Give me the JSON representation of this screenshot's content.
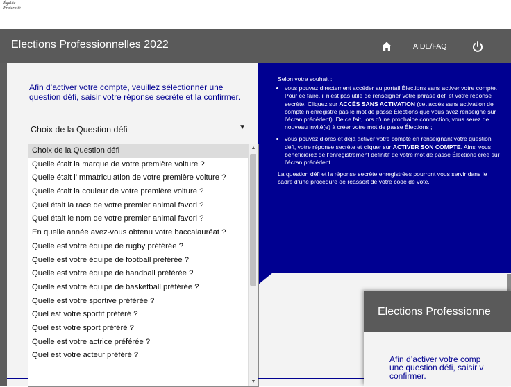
{
  "topstrip": {
    "motto_line1": "Égalité",
    "motto_line2": "Fraternité"
  },
  "header": {
    "title": "Elections Professionnelles 2022",
    "home_icon": "home-icon",
    "aide_label": "AIDE/FAQ",
    "power_icon": "power-icon"
  },
  "instruction": "Afin d’activer votre compte, veuillez sélectionner une question défi, saisir votre réponse secrète et la confirmer.",
  "question_select": {
    "selected": "Choix de la Question défi",
    "options": [
      "Choix de la Question défi",
      "Quelle était la marque de votre première voiture ?",
      "Quelle était l’immatriculation de votre première voiture ?",
      "Quelle était la couleur de votre première voiture ?",
      "Quel était la race de votre premier animal favori ?",
      "Quel était le nom de votre premier animal favori ?",
      "En quelle année avez-vous obtenu votre baccalauréat ?",
      "Quelle est votre équipe de rugby préférée ?",
      "Quelle est votre équipe de football préférée ?",
      "Quelle est votre équipe de handball préférée ?",
      "Quelle est votre équipe de basketball préférée ?",
      "Quelle est votre sportive préférée ?",
      "Quel est votre sportif préféré ?",
      "Quel est votre sport préféré ?",
      "Quelle est votre actrice préférée ?",
      "Quel est votre acteur préféré ?"
    ]
  },
  "info": {
    "intro": "Selon votre souhait :",
    "b1_pre": "vous pouvez directement accéder au portail Élections sans activer votre compte. Pour ce faire, il n’est pas utile de renseigner votre phrase défi et votre réponse secrète. Cliquez sur ",
    "b1_strong": "ACCÈS SANS ACTIVATION",
    "b1_post": " (cet accès sans activation de compte n’enregistre pas le mot de passe Élections que vous avez renseigné sur l’écran précédent). De ce fait, lors d’une prochaine connection, vous serez de nouveau invité(e) à créer votre mot de passe Élections ;",
    "b2_pre": "vous pouvez d’ores et déjà activer votre compte en renseignant votre question défi, votre réponse secrète et cliquer sur ",
    "b2_strong": "ACTIVER SON COMPTE",
    "b2_post": ". Ainsi vous bénéficierez de l’enregistrement définitif de votre mot de passe Élections créé sur l’écran précédent.",
    "outro": "La question défi et la réponse secrète enregistrées pourront vous servir dans le cadre d’une procédure de réassort de votre code de vote."
  },
  "second_window": {
    "title": "Elections Professionne",
    "line1": "Afin d’activer votre comp",
    "line2": "une question défi, saisir v",
    "line3": "confirmer."
  }
}
